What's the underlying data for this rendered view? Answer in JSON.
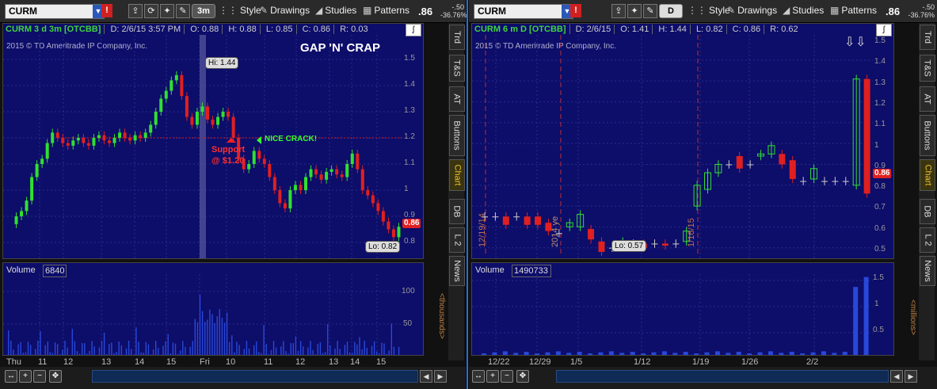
{
  "left": {
    "symbol": "CURM",
    "timeframe": "3m",
    "toolbar": {
      "style": "Style",
      "drawings": "Drawings",
      "studies": "Studies",
      "patterns": "Patterns"
    },
    "last": ".86",
    "chg1": "-.50",
    "chg2": "-36.76%",
    "header": {
      "title": "CURM 3 d 3m [OTCBB]",
      "date": "D: 2/6/15 3:57 PM",
      "open": "O: 0.88",
      "high": "H: 0.88",
      "low": "L: 0.85",
      "close": "C: 0.86",
      "range": "R: 0.03"
    },
    "copyright": "2015 © TD Ameritrade IP Company, Inc.",
    "annotations": {
      "title": "GAP 'N' CRAP",
      "support1": "Support",
      "support2": "@ $1.20",
      "crack": "NICE CRACK!",
      "hi": "Hi: 1.44",
      "lo": "Lo: 0.82",
      "price": "0.86"
    },
    "price_ticks": [
      "1.5",
      "1.4",
      "1.3",
      "1.2",
      "1.1",
      "1",
      "0.9",
      "0.8"
    ],
    "volume": {
      "label": "Volume",
      "value": "6840",
      "ticks": [
        "100",
        "50"
      ],
      "unit": "<thousands>"
    },
    "dates": [
      "Thu",
      "11",
      "12",
      "13",
      "14",
      "15",
      "Fri",
      "10",
      "11",
      "12",
      "13",
      "14",
      "15"
    ],
    "side_tabs": [
      "Trd",
      "T&S",
      "AT",
      "Buttons",
      "Chart",
      "DB",
      "L 2",
      "News"
    ]
  },
  "right": {
    "symbol": "CURM",
    "timeframe": "D",
    "toolbar": {
      "style": "Style",
      "drawings": "Drawings",
      "studies": "Studies",
      "patterns": "Patterns"
    },
    "last": ".86",
    "chg1": "-.50",
    "chg2": "-36.76%",
    "header": {
      "title": "CURM 6 m D [OTCBB]",
      "date": "D: 2/6/15",
      "open": "O: 1.41",
      "high": "H: 1.44",
      "low": "L: 0.82",
      "close": "C: 0.86",
      "range": "R: 0.62"
    },
    "copyright": "2015 © TD Ameritrade IP Company, Inc.",
    "annotations": {
      "lo": "Lo: 0.57",
      "price": "0.86",
      "v1": "12/19/14",
      "v2": "2014 ye",
      "v3": "1/16/15"
    },
    "price_ticks": [
      "1.5",
      "1.4",
      "1.3",
      "1.2",
      "1.1",
      "1",
      "0.9",
      "0.8",
      "0.7",
      "0.6",
      "0.5"
    ],
    "volume": {
      "label": "Volume",
      "value": "1490733",
      "ticks": [
        "1.5",
        "1",
        "0.5"
      ],
      "unit": "<millions>"
    },
    "dates": [
      "12/22",
      "12/29",
      "1/5",
      "1/12",
      "1/19",
      "1/26",
      "2/2"
    ],
    "side_tabs": [
      "Trd",
      "T&S",
      "AT",
      "Buttons",
      "Chart",
      "DB",
      "L 2",
      "News"
    ]
  },
  "chart_data": [
    {
      "type": "candlestick",
      "title": "CURM 3 d 3m [OTCBB]",
      "ylim": [
        0.75,
        1.55
      ],
      "hi": 1.44,
      "lo": 0.82,
      "support": 1.2,
      "last": 0.86
    },
    {
      "type": "candlestick",
      "title": "CURM 6 m D [OTCBB]",
      "ylim": [
        0.45,
        1.55
      ],
      "hi": 1.44,
      "lo": 0.57,
      "last": 0.86
    }
  ]
}
